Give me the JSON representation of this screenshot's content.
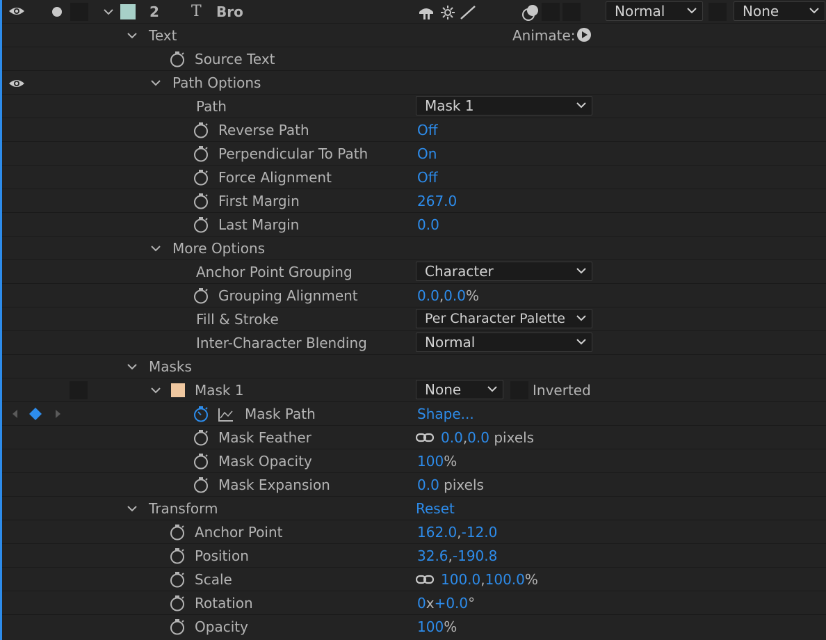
{
  "layer": {
    "number": "2",
    "type_icon": "T",
    "name": "Bro",
    "label_color": "#a7d0c8",
    "mode": "Normal",
    "trkmat": "None"
  },
  "text_group": {
    "label": "Text",
    "animate_label": "Animate:",
    "source_text": "Source Text"
  },
  "path_options": {
    "label": "Path Options",
    "path_label": "Path",
    "path_value": "Mask 1",
    "reverse_path": {
      "label": "Reverse Path",
      "value": "Off"
    },
    "perpendicular": {
      "label": "Perpendicular To Path",
      "value": "On"
    },
    "force_alignment": {
      "label": "Force Alignment",
      "value": "Off"
    },
    "first_margin": {
      "label": "First Margin",
      "value": "267.0"
    },
    "last_margin": {
      "label": "Last Margin",
      "value": "0.0"
    }
  },
  "more_options": {
    "label": "More Options",
    "anchor_grouping": {
      "label": "Anchor Point Grouping",
      "value": "Character"
    },
    "grouping_alignment": {
      "label": "Grouping Alignment",
      "x": "0.0",
      "y": "0.0",
      "unit": "%"
    },
    "fill_stroke": {
      "label": "Fill & Stroke",
      "value": "Per Character Palette"
    },
    "blending": {
      "label": "Inter-Character Blending",
      "value": "Normal"
    }
  },
  "masks": {
    "label": "Masks",
    "mask1": {
      "label": "Mask 1",
      "color": "#f0c8a0",
      "mode": "None",
      "inverted_label": "Inverted"
    },
    "mask_path": {
      "label": "Mask Path",
      "value": "Shape..."
    },
    "mask_feather": {
      "label": "Mask Feather",
      "x": "0.0",
      "y": "0.0",
      "unit": "pixels"
    },
    "mask_opacity": {
      "label": "Mask Opacity",
      "value": "100",
      "unit": "%"
    },
    "mask_expansion": {
      "label": "Mask Expansion",
      "value": "0.0",
      "unit": "pixels"
    }
  },
  "transform": {
    "label": "Transform",
    "reset_label": "Reset",
    "anchor_point": {
      "label": "Anchor Point",
      "x": "162.0",
      "y": "-12.0"
    },
    "position": {
      "label": "Position",
      "x": "32.6",
      "y": "-190.8"
    },
    "scale": {
      "label": "Scale",
      "x": "100.0",
      "y": "100.0",
      "unit": "%"
    },
    "rotation": {
      "label": "Rotation",
      "turns": "0",
      "x_sep": "x",
      "degrees": "+0.0",
      "deg_unit": "°"
    },
    "opacity": {
      "label": "Opacity",
      "value": "100",
      "unit": "%"
    }
  },
  "separators": {
    "comma": ","
  },
  "colors": {
    "background": "#232323",
    "value_blue": "#2d8ceb",
    "label_gray": "#b4b4b4"
  }
}
